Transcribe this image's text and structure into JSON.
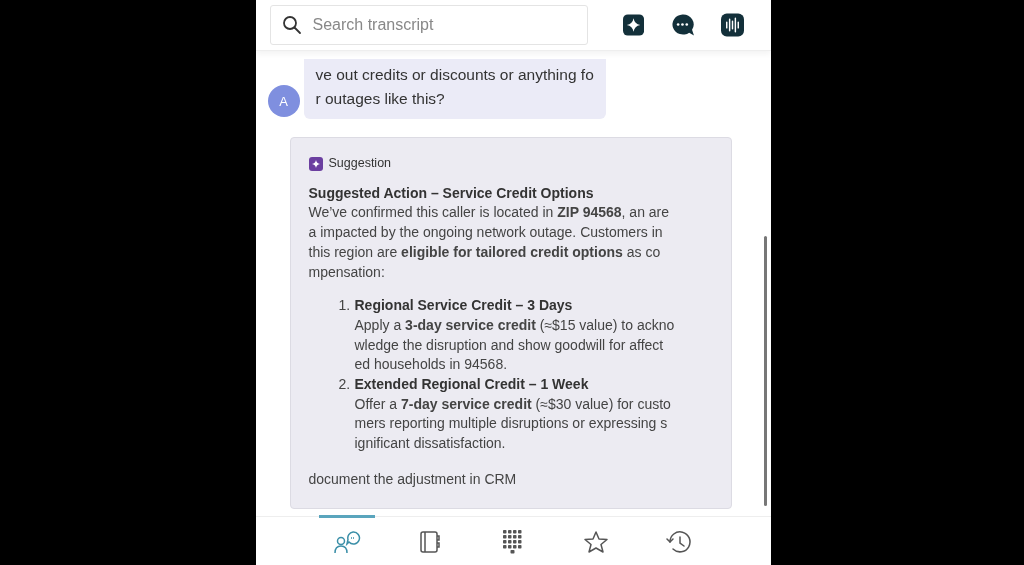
{
  "search": {
    "placeholder": "Search transcript"
  },
  "message": {
    "avatar": "A",
    "lines": [
      "ve out credits or discounts or anything fo",
      "r outages like this?"
    ]
  },
  "suggestion": {
    "label": "Suggestion",
    "title": "Suggested Action – Service Credit Options",
    "intro": [
      "We’ve confirmed this caller is located in **ZIP 94568**, an are",
      "a impacted by the ongoing network outage. Customers in",
      "this region are **eligible for tailored credit options** as co",
      "mpensation:"
    ],
    "options": [
      {
        "number": "1.",
        "title": "Regional Service Credit – 3 Days",
        "lines": [
          "Apply a **3-day service credit** (≈$15 value) to ackno",
          "wledge the disruption and show goodwill for affect",
          "ed households in 94568."
        ]
      },
      {
        "number": "2.",
        "title": "Extended Regional Credit – 1 Week",
        "lines": [
          "Offer a **7-day service credit** (≈$30 value) for custo",
          "mers reporting multiple disruptions or expressing s",
          "ignificant dissatisfaction."
        ]
      }
    ],
    "footer": "document the adjustment in CRM"
  },
  "nav": [
    {
      "kind": "conversation",
      "selected": true
    },
    {
      "kind": "notebook",
      "selected": false
    },
    {
      "kind": "dialpad",
      "selected": false
    },
    {
      "kind": "star",
      "selected": false
    },
    {
      "kind": "history",
      "selected": false
    }
  ]
}
